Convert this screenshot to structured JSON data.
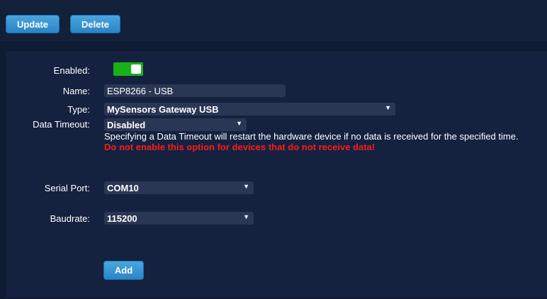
{
  "toolbar": {
    "update_label": "Update",
    "delete_label": "Delete"
  },
  "form": {
    "enabled_label": "Enabled:",
    "enabled_value": true,
    "name_label": "Name:",
    "name_value": "ESP8266 - USB",
    "type_label": "Type:",
    "type_value": "MySensors Gateway USB",
    "timeout_label": "Data Timeout:",
    "timeout_value": "Disabled",
    "timeout_info": "Specifying a Data Timeout will restart the hardware device if no data is received for the specified time.",
    "timeout_warning": "Do not enable this option for devices that do not receive data!",
    "serial_label": "Serial Port:",
    "serial_value": "COM10",
    "baud_label": "Baudrate:",
    "baud_value": "115200",
    "add_label": "Add"
  },
  "icons": {
    "dropdown": "chevron-down-icon"
  },
  "colors": {
    "background": "#0f1a33",
    "panel": "#14213f",
    "button": "#2a84c6",
    "toggle_on": "#18b218",
    "warning": "#ff1a1a"
  }
}
